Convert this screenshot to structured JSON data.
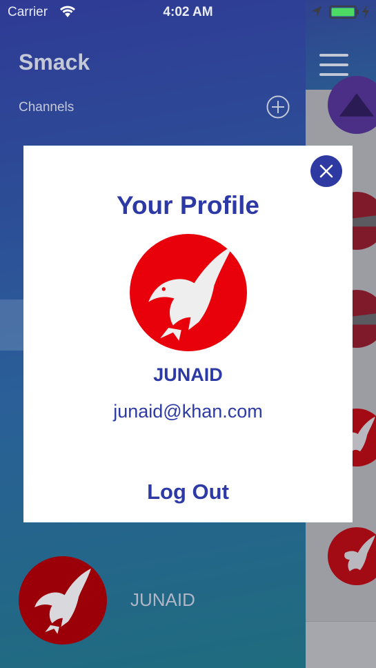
{
  "status_bar": {
    "carrier": "Carrier",
    "time": "4:02 AM"
  },
  "menu": {
    "app_title": "Smack",
    "channels_label": "Channels",
    "user_name": "JUNAID"
  },
  "profile_modal": {
    "title": "Your Profile",
    "name": "JUNAID",
    "email": "junaid@khan.com",
    "logout_label": "Log Out"
  },
  "colors": {
    "accent": "#2d3aa5",
    "avatar_red": "#e8000b",
    "battery_green": "#4cd964"
  },
  "icons": {
    "close": "close-icon",
    "add": "add-circle-icon",
    "menu": "hamburger-icon",
    "avatar": "eagle-icon"
  }
}
